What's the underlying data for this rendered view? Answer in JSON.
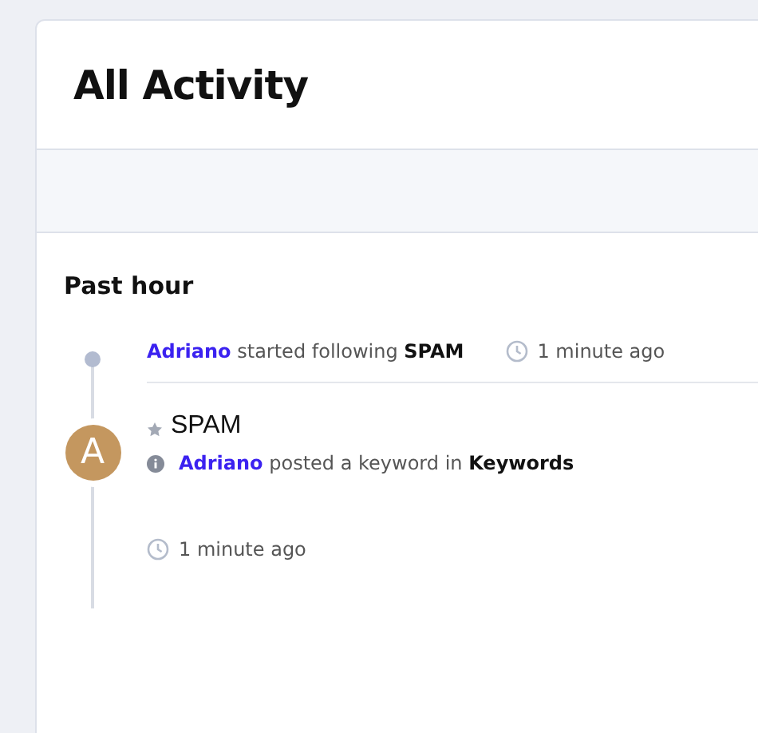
{
  "page": {
    "title": "All Activity"
  },
  "section": {
    "title": "Past hour"
  },
  "activities": [
    {
      "kind": "follow",
      "actor": "Adriano",
      "verb": "started following",
      "target": "SPAM",
      "time": "1 minute ago"
    },
    {
      "kind": "post",
      "avatar": "A",
      "starred": false,
      "title": "SPAM",
      "actor": "Adriano",
      "verb": "posted a keyword in",
      "target": "Keywords",
      "time": "1 minute ago"
    }
  ]
}
